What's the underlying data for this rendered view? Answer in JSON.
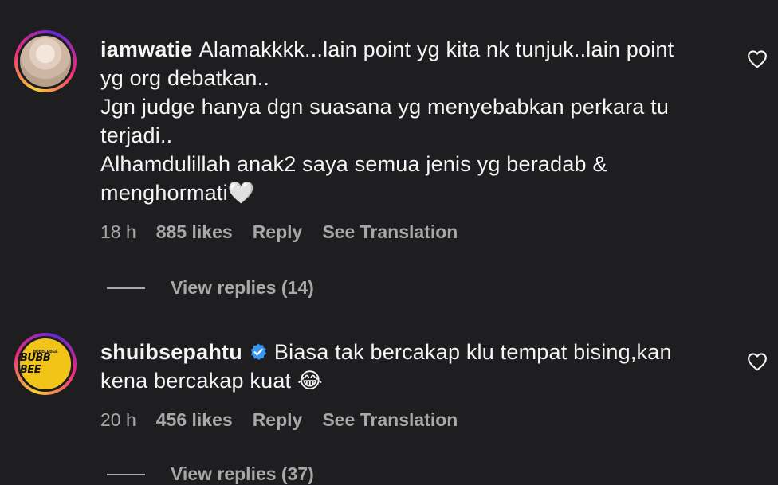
{
  "comments": [
    {
      "username": "iamwatie",
      "lines": [
        "Alamakkkk...lain point yg kita nk tunjuk..lain point",
        "yg org debatkan..",
        "Jgn judge hanya dgn suasana yg menyebabkan perkara tu",
        "terjadi..",
        "Alhamdulillah anak2 saya semua jenis yg beradab &",
        "menghormati"
      ],
      "emoji": "🤍",
      "time": "18 h",
      "likes": "885 likes",
      "reply_label": "Reply",
      "translate_label": "See Translation",
      "view_replies": "View replies (14)",
      "avatar_icon": "profile-photo-hijab"
    },
    {
      "username": "shuibsepahtu",
      "verified": true,
      "lines": [
        "Biasa tak bercakap klu tempat bising,kan",
        "kena bercakap kuat"
      ],
      "emoji": "😂",
      "time": "20 h",
      "likes": "456 likes",
      "reply_label": "Reply",
      "translate_label": "See Translation",
      "view_replies": "View replies (37)",
      "avatar_logo_text": "BUBB BEE",
      "avatar_logo_top": "BUBBLEBEE"
    }
  ],
  "colors": {
    "background": "#1e1e20",
    "text": "#f5f5f5",
    "muted": "#a8a8a8",
    "verified": "#3897f0",
    "logo_yellow": "#f2c418"
  },
  "icons": {
    "like": "heart-outline-icon",
    "verified": "verified-badge-icon"
  }
}
